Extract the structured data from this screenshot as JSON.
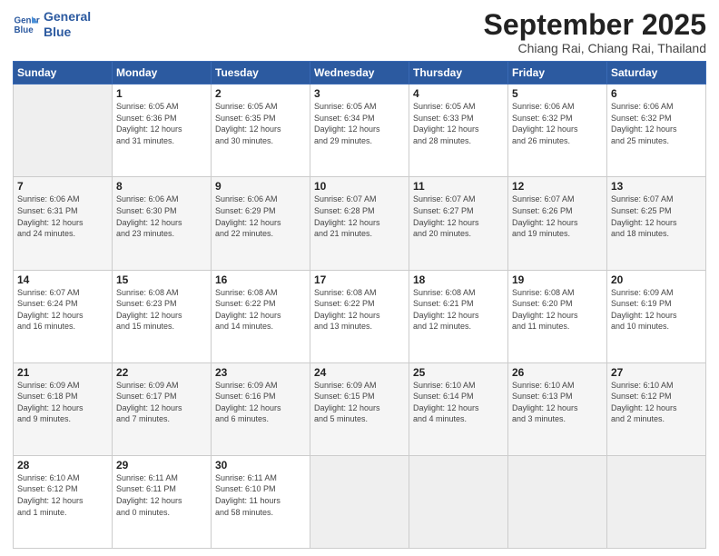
{
  "logo": {
    "text_general": "General",
    "text_blue": "Blue"
  },
  "header": {
    "month": "September 2025",
    "location": "Chiang Rai, Chiang Rai, Thailand"
  },
  "days_of_week": [
    "Sunday",
    "Monday",
    "Tuesday",
    "Wednesday",
    "Thursday",
    "Friday",
    "Saturday"
  ],
  "weeks": [
    [
      {
        "day": "",
        "info": ""
      },
      {
        "day": "1",
        "info": "Sunrise: 6:05 AM\nSunset: 6:36 PM\nDaylight: 12 hours\nand 31 minutes."
      },
      {
        "day": "2",
        "info": "Sunrise: 6:05 AM\nSunset: 6:35 PM\nDaylight: 12 hours\nand 30 minutes."
      },
      {
        "day": "3",
        "info": "Sunrise: 6:05 AM\nSunset: 6:34 PM\nDaylight: 12 hours\nand 29 minutes."
      },
      {
        "day": "4",
        "info": "Sunrise: 6:05 AM\nSunset: 6:33 PM\nDaylight: 12 hours\nand 28 minutes."
      },
      {
        "day": "5",
        "info": "Sunrise: 6:06 AM\nSunset: 6:32 PM\nDaylight: 12 hours\nand 26 minutes."
      },
      {
        "day": "6",
        "info": "Sunrise: 6:06 AM\nSunset: 6:32 PM\nDaylight: 12 hours\nand 25 minutes."
      }
    ],
    [
      {
        "day": "7",
        "info": "Sunrise: 6:06 AM\nSunset: 6:31 PM\nDaylight: 12 hours\nand 24 minutes."
      },
      {
        "day": "8",
        "info": "Sunrise: 6:06 AM\nSunset: 6:30 PM\nDaylight: 12 hours\nand 23 minutes."
      },
      {
        "day": "9",
        "info": "Sunrise: 6:06 AM\nSunset: 6:29 PM\nDaylight: 12 hours\nand 22 minutes."
      },
      {
        "day": "10",
        "info": "Sunrise: 6:07 AM\nSunset: 6:28 PM\nDaylight: 12 hours\nand 21 minutes."
      },
      {
        "day": "11",
        "info": "Sunrise: 6:07 AM\nSunset: 6:27 PM\nDaylight: 12 hours\nand 20 minutes."
      },
      {
        "day": "12",
        "info": "Sunrise: 6:07 AM\nSunset: 6:26 PM\nDaylight: 12 hours\nand 19 minutes."
      },
      {
        "day": "13",
        "info": "Sunrise: 6:07 AM\nSunset: 6:25 PM\nDaylight: 12 hours\nand 18 minutes."
      }
    ],
    [
      {
        "day": "14",
        "info": "Sunrise: 6:07 AM\nSunset: 6:24 PM\nDaylight: 12 hours\nand 16 minutes."
      },
      {
        "day": "15",
        "info": "Sunrise: 6:08 AM\nSunset: 6:23 PM\nDaylight: 12 hours\nand 15 minutes."
      },
      {
        "day": "16",
        "info": "Sunrise: 6:08 AM\nSunset: 6:22 PM\nDaylight: 12 hours\nand 14 minutes."
      },
      {
        "day": "17",
        "info": "Sunrise: 6:08 AM\nSunset: 6:22 PM\nDaylight: 12 hours\nand 13 minutes."
      },
      {
        "day": "18",
        "info": "Sunrise: 6:08 AM\nSunset: 6:21 PM\nDaylight: 12 hours\nand 12 minutes."
      },
      {
        "day": "19",
        "info": "Sunrise: 6:08 AM\nSunset: 6:20 PM\nDaylight: 12 hours\nand 11 minutes."
      },
      {
        "day": "20",
        "info": "Sunrise: 6:09 AM\nSunset: 6:19 PM\nDaylight: 12 hours\nand 10 minutes."
      }
    ],
    [
      {
        "day": "21",
        "info": "Sunrise: 6:09 AM\nSunset: 6:18 PM\nDaylight: 12 hours\nand 9 minutes."
      },
      {
        "day": "22",
        "info": "Sunrise: 6:09 AM\nSunset: 6:17 PM\nDaylight: 12 hours\nand 7 minutes."
      },
      {
        "day": "23",
        "info": "Sunrise: 6:09 AM\nSunset: 6:16 PM\nDaylight: 12 hours\nand 6 minutes."
      },
      {
        "day": "24",
        "info": "Sunrise: 6:09 AM\nSunset: 6:15 PM\nDaylight: 12 hours\nand 5 minutes."
      },
      {
        "day": "25",
        "info": "Sunrise: 6:10 AM\nSunset: 6:14 PM\nDaylight: 12 hours\nand 4 minutes."
      },
      {
        "day": "26",
        "info": "Sunrise: 6:10 AM\nSunset: 6:13 PM\nDaylight: 12 hours\nand 3 minutes."
      },
      {
        "day": "27",
        "info": "Sunrise: 6:10 AM\nSunset: 6:12 PM\nDaylight: 12 hours\nand 2 minutes."
      }
    ],
    [
      {
        "day": "28",
        "info": "Sunrise: 6:10 AM\nSunset: 6:12 PM\nDaylight: 12 hours\nand 1 minute."
      },
      {
        "day": "29",
        "info": "Sunrise: 6:11 AM\nSunset: 6:11 PM\nDaylight: 12 hours\nand 0 minutes."
      },
      {
        "day": "30",
        "info": "Sunrise: 6:11 AM\nSunset: 6:10 PM\nDaylight: 11 hours\nand 58 minutes."
      },
      {
        "day": "",
        "info": ""
      },
      {
        "day": "",
        "info": ""
      },
      {
        "day": "",
        "info": ""
      },
      {
        "day": "",
        "info": ""
      }
    ]
  ]
}
